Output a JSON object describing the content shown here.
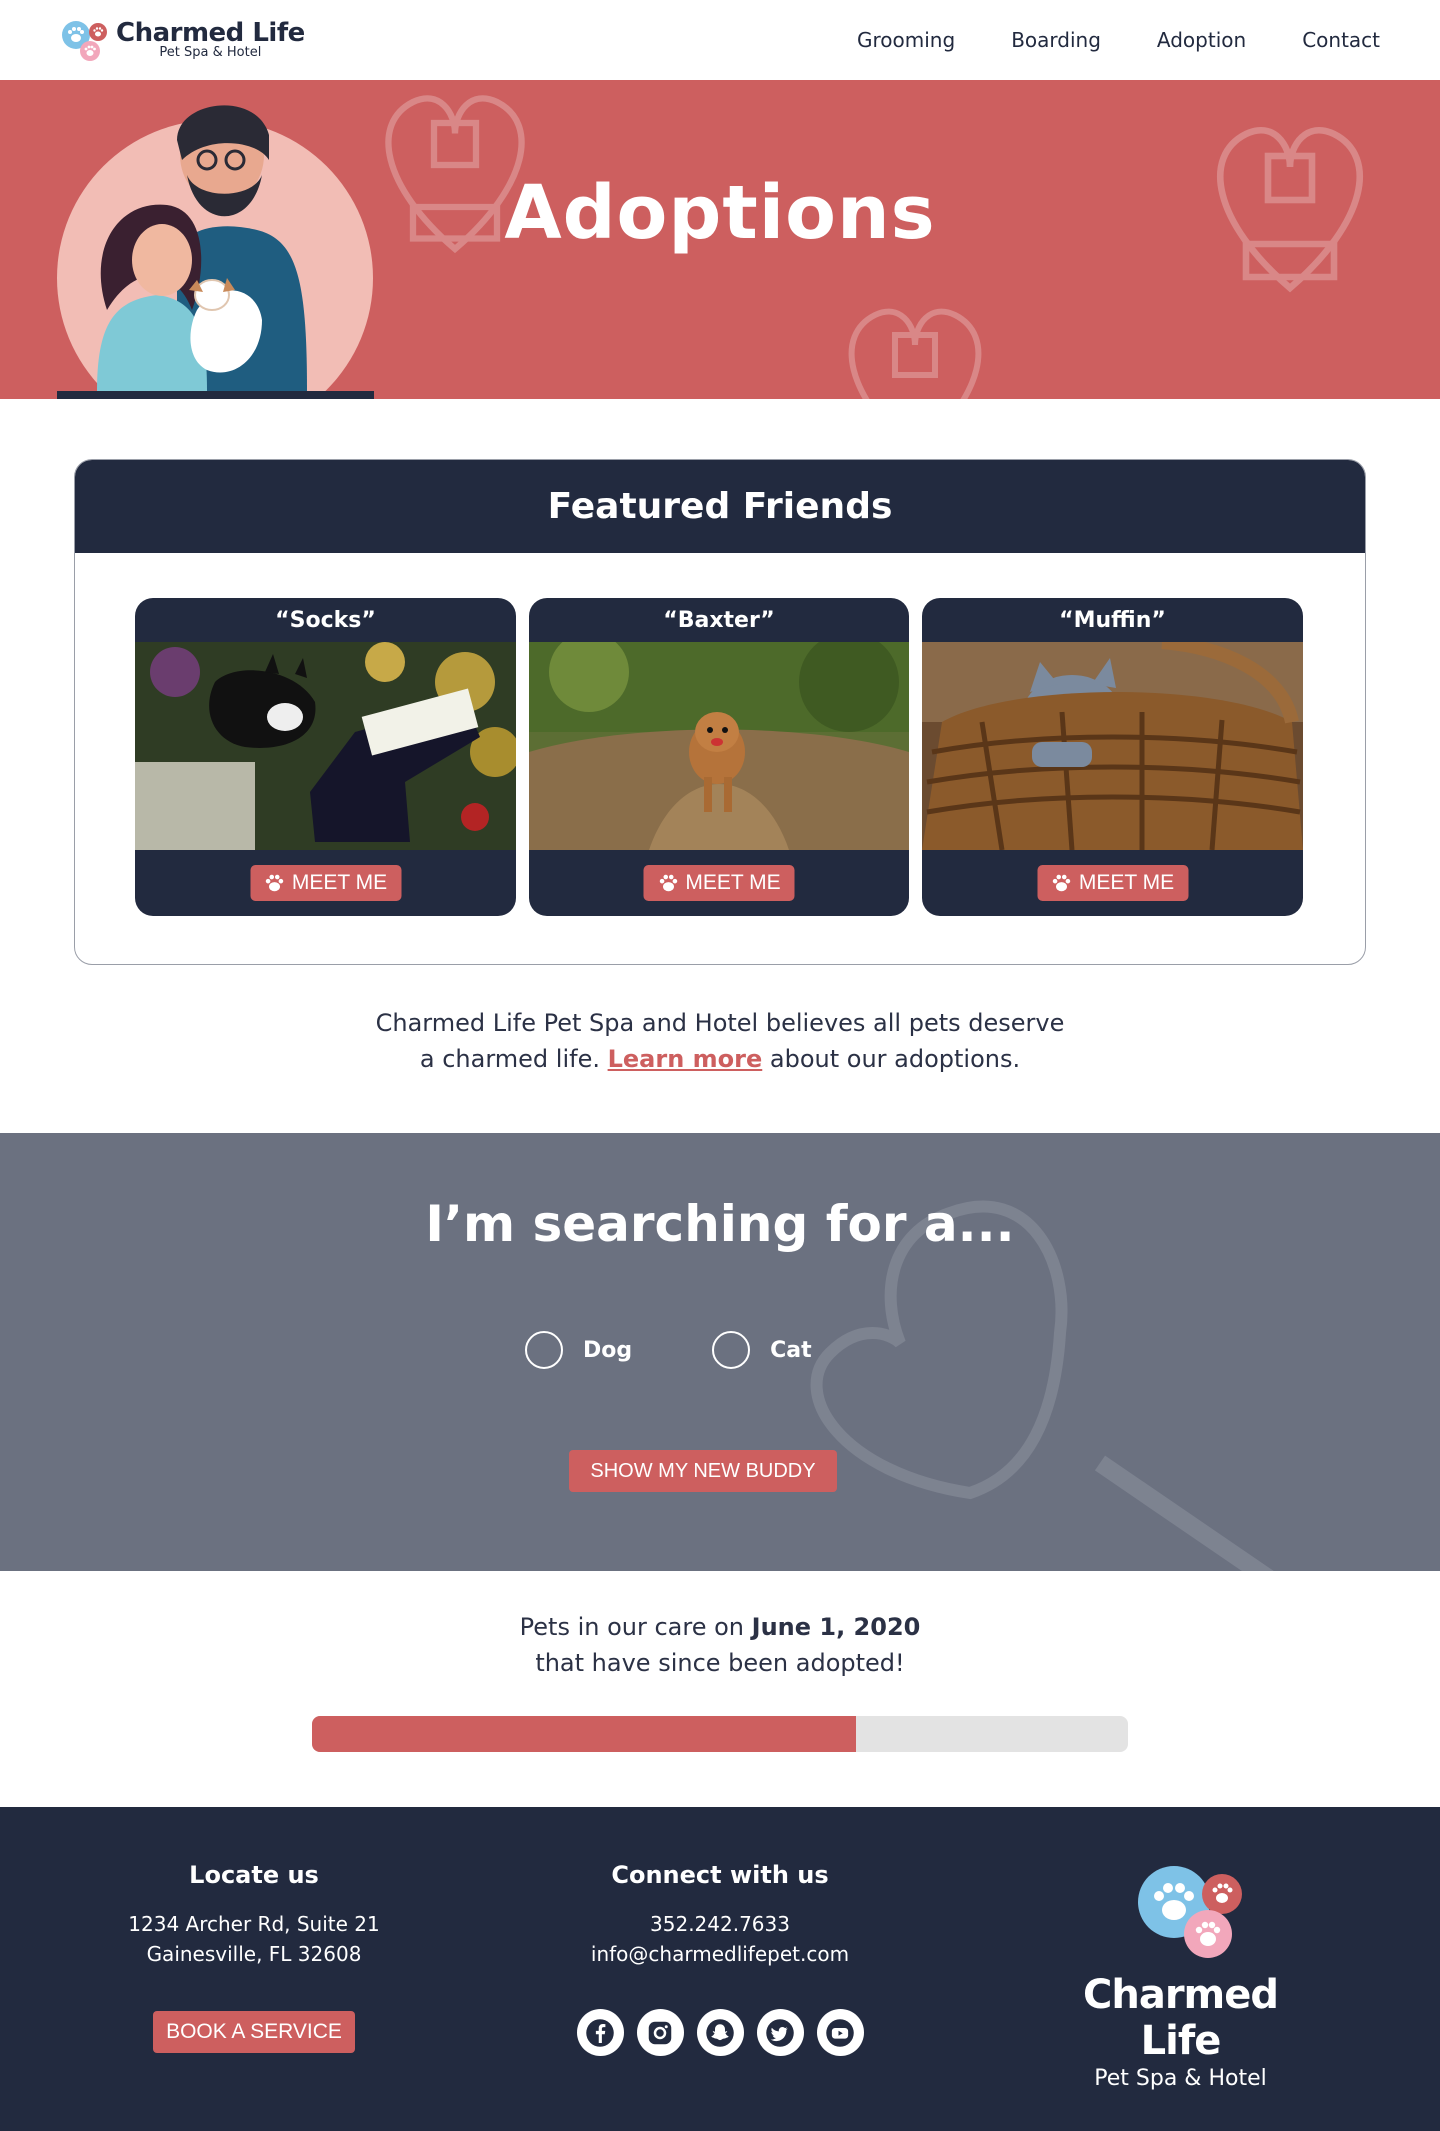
{
  "nav": {
    "logo_title": "Charmed Life",
    "logo_sub": "Pet Spa & Hotel",
    "links": [
      "Grooming",
      "Boarding",
      "Adoption",
      "Contact"
    ]
  },
  "hero": {
    "title": "Adoptions"
  },
  "featured": {
    "title": "Featured Friends",
    "pets": [
      {
        "name": "“Socks”",
        "button": "MEET ME"
      },
      {
        "name": "“Baxter”",
        "button": "MEET ME"
      },
      {
        "name": "“Muffin”",
        "button": "MEET ME"
      }
    ]
  },
  "intro": {
    "line1": "Charmed Life Pet Spa and Hotel believes all pets deserve",
    "line2_pre": "a charmed life. ",
    "link": "Learn more",
    "line2_post": " about our adoptions."
  },
  "search": {
    "title": "I’m searching for a...",
    "options": [
      "Dog",
      "Cat"
    ],
    "button": "SHOW MY NEW BUDDY"
  },
  "adopted": {
    "line1_pre": "Pets in our care on ",
    "date": "June 1, 2020",
    "line2": "that have since been adopted!",
    "progress_fraction": 0.667
  },
  "footer": {
    "locate_title": "Locate us",
    "address1": "1234 Archer Rd, Suite 21",
    "address2": "Gainesville, FL 32608",
    "book_button": "BOOK A SERVICE",
    "connect_title": "Connect with us",
    "phone": "352.242.7633",
    "email": "info@charmedlifepet.com",
    "socials": [
      "facebook-icon",
      "instagram-icon",
      "snapchat-icon",
      "twitter-icon",
      "youtube-icon"
    ],
    "logo_title": "Charmed Life",
    "logo_sub": "Pet Spa & Hotel"
  },
  "colors": {
    "navy": "#222a3f",
    "coral": "#cd5f5f",
    "slate": "#6b7180",
    "blue": "#7ec2e7",
    "pink": "#f2a7bb"
  }
}
